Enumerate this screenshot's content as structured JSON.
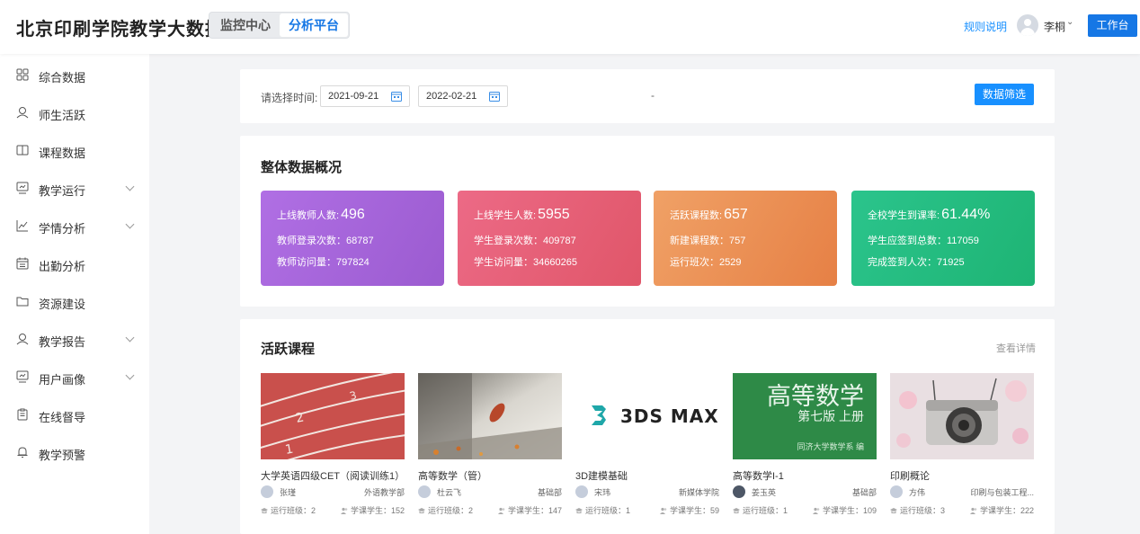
{
  "header": {
    "brand": "北京印刷学院教学大数据",
    "tabs": [
      "监控中心",
      "分析平台"
    ],
    "rules_link": "规则说明",
    "user_name": "李桐",
    "workbench_button": "工作台"
  },
  "sidebar": {
    "items": [
      {
        "label": "综合数据",
        "icon": "grid-icon",
        "expandable": false
      },
      {
        "label": "师生活跃",
        "icon": "user-icon",
        "expandable": false
      },
      {
        "label": "课程数据",
        "icon": "book-icon",
        "expandable": false
      },
      {
        "label": "教学运行",
        "icon": "monitor-icon",
        "expandable": true
      },
      {
        "label": "学情分析",
        "icon": "line-chart-icon",
        "expandable": true
      },
      {
        "label": "出勤分析",
        "icon": "calendar-icon",
        "expandable": false
      },
      {
        "label": "资源建设",
        "icon": "folder-icon",
        "expandable": false
      },
      {
        "label": "教学报告",
        "icon": "user-icon",
        "expandable": true
      },
      {
        "label": "用户画像",
        "icon": "monitor-icon",
        "expandable": true
      },
      {
        "label": "在线督导",
        "icon": "clipboard-icon",
        "expandable": false
      },
      {
        "label": "教学预警",
        "icon": "bell-icon",
        "expandable": false
      }
    ]
  },
  "filter": {
    "label": "请选择时间:",
    "start_date": "2021-09-21",
    "end_date": "2022-02-21",
    "separator": "-",
    "button": "数据筛选"
  },
  "overview": {
    "title": "整体数据概况",
    "cards": [
      {
        "l1_label": "上线教师人数:",
        "l1_value": "496",
        "l2": "教师登录次数：68787",
        "l3": "教师访问量：797824",
        "color": "#a866dc"
      },
      {
        "l1_label": "上线学生人数:",
        "l1_value": "5955",
        "l2": "学生登录次数：409787",
        "l3": "学生访问量：34660265",
        "color": "#e8607a"
      },
      {
        "l1_label": "活跃课程数:",
        "l1_value": "657",
        "l2": "新建课程数：757",
        "l3": "运行班次：2529",
        "color": "#ec9256"
      },
      {
        "l1_label": "全校学生到课率:",
        "l1_value": "61.44%",
        "l2": "学生应签到总数：117059",
        "l3": "完成签到人次：71925",
        "color": "#25bd82"
      }
    ]
  },
  "courses": {
    "title": "活跃课程",
    "more_link": "查看详情",
    "thumb_texts": {
      "max_logo": "3DS MAX",
      "book_title": "高等数学",
      "book_edition": "第七版 上册",
      "book_publisher": "同济大学数学系 编"
    },
    "items": [
      {
        "name": "大学英语四级CET（阅读训练1）",
        "teacher": "张瑾",
        "dept": "外语教学部",
        "classes": "运行班级：2",
        "students": "学课学生：152",
        "thumb": "track"
      },
      {
        "name": "高等数学（管）",
        "teacher": "杜云飞",
        "dept": "基础部",
        "classes": "运行班级：2",
        "students": "学课学生：147",
        "thumb": "leaf"
      },
      {
        "name": "3D建模基础",
        "teacher": "宋玮",
        "dept": "新媒体学院",
        "classes": "运行班级：1",
        "students": "学课学生：59",
        "thumb": "max"
      },
      {
        "name": "高等数学I-1",
        "teacher": "姜玉英",
        "dept": "基础部",
        "classes": "运行班级：1",
        "students": "学课学生：109",
        "thumb": "book"
      },
      {
        "name": "印刷概论",
        "teacher": "方伟",
        "dept": "印刷与包装工程...",
        "classes": "运行班级：3",
        "students": "学课学生：222",
        "thumb": "camera"
      }
    ]
  }
}
